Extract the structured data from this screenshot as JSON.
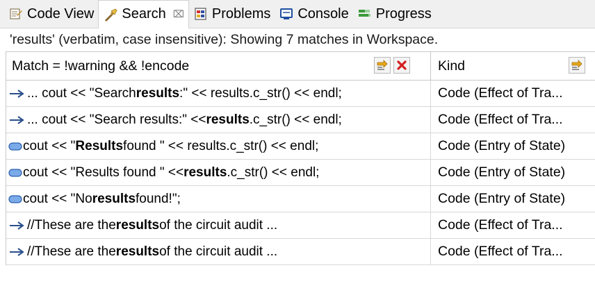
{
  "tabs": [
    {
      "label": "Code View",
      "icon": "code-view-icon"
    },
    {
      "label": "Search",
      "icon": "search-flashlight-icon",
      "close": "⌧",
      "active": true
    },
    {
      "label": "Problems",
      "icon": "problems-icon"
    },
    {
      "label": "Console",
      "icon": "console-icon"
    },
    {
      "label": "Progress",
      "icon": "progress-icon"
    }
  ],
  "status": "'results' (verbatim, case insensitive): Showing 7 matches in Workspace.",
  "columns": {
    "match": "Match = !warning && !encode",
    "kind": "Kind"
  },
  "rows": [
    {
      "icon": "arrow-icon",
      "pre": "... cout << \"Search ",
      "match": "results",
      "post": ":\" << results.c_str() << endl;",
      "kind": "Code (Effect of Tra..."
    },
    {
      "icon": "arrow-icon",
      "pre": "... cout << \"Search results:\" << ",
      "match": "results",
      "post": ".c_str() << endl;",
      "kind": "Code (Effect of Tra..."
    },
    {
      "icon": "state-icon",
      "pre": "cout << \"",
      "match": "Results",
      "post": " found \" << results.c_str() << endl;",
      "kind": "Code (Entry of State)"
    },
    {
      "icon": "state-icon",
      "pre": "cout << \"Results found \" << ",
      "match": "results",
      "post": ".c_str() << endl;",
      "kind": "Code (Entry of State)"
    },
    {
      "icon": "state-icon",
      "pre": "cout << \"No ",
      "match": "results",
      "post": " found!\";",
      "kind": "Code (Entry of State)"
    },
    {
      "icon": "arrow-icon",
      "pre": "//These are the ",
      "match": "results",
      "post": " of the circuit audit ...",
      "kind": "Code (Effect of Tra..."
    },
    {
      "icon": "arrow-icon",
      "pre": "//These are the ",
      "match": "results",
      "post": " of the circuit audit ...",
      "kind": "Code (Effect of Tra..."
    }
  ],
  "colors": {
    "arrow": "#2a4f8c",
    "state": "#5a8fd6",
    "remove": "#d42020",
    "filter": "#e0a020"
  }
}
